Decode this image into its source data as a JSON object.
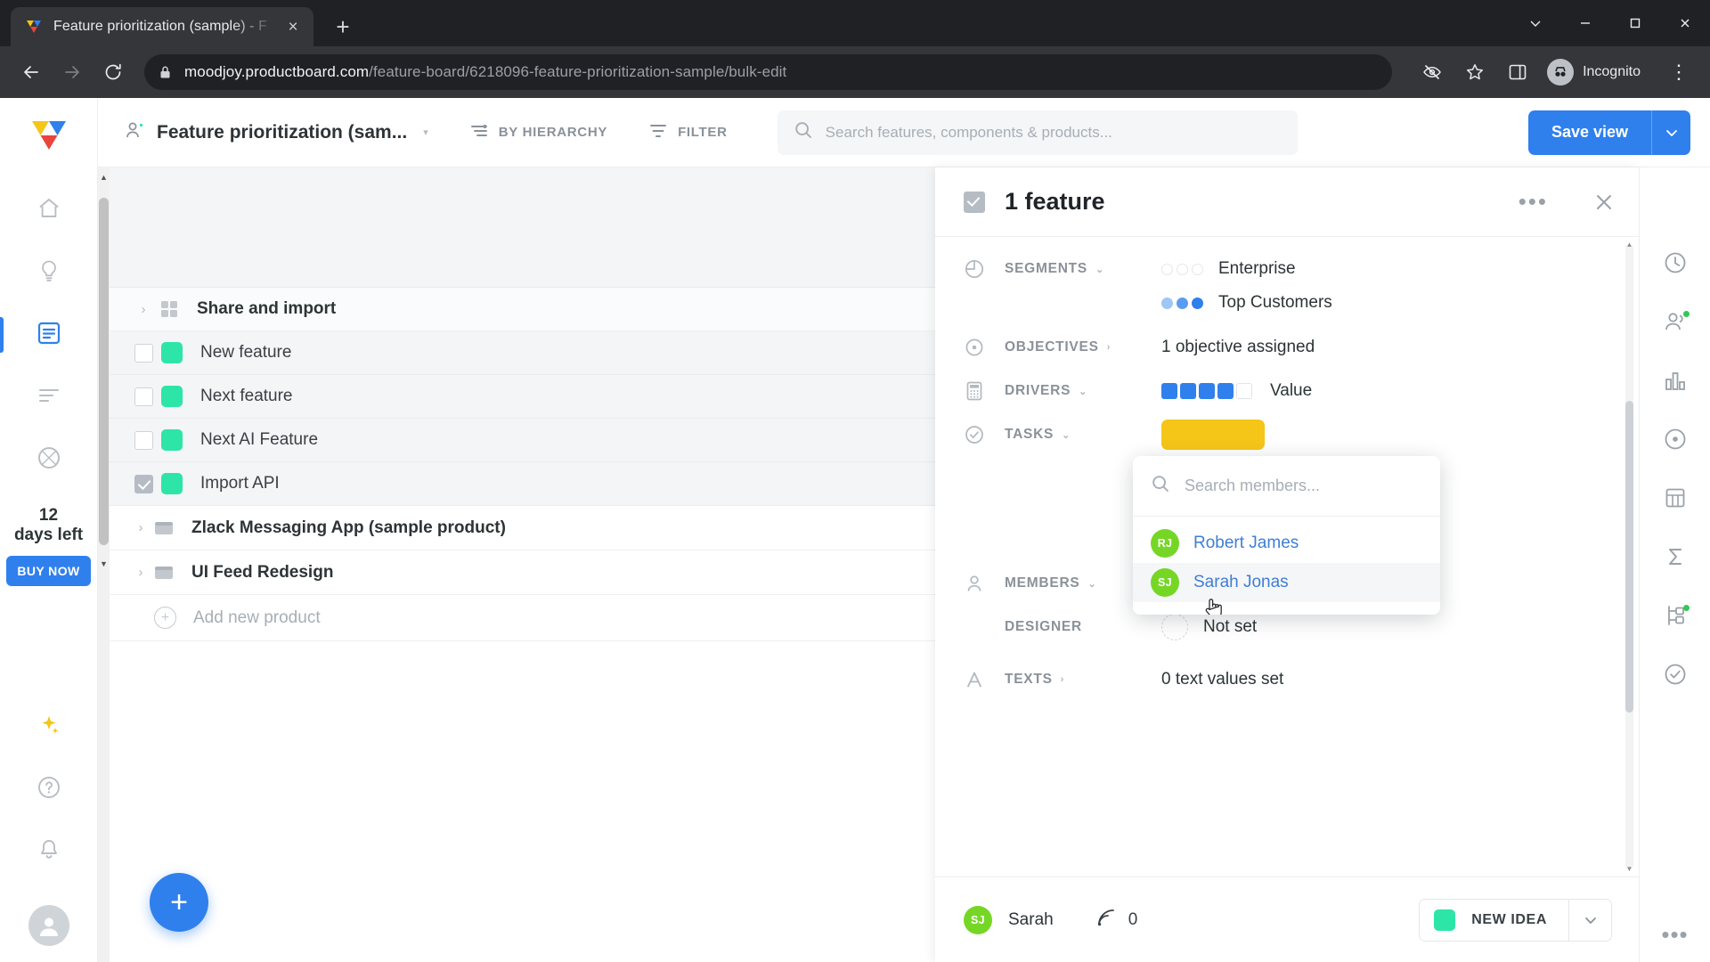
{
  "browser": {
    "tab": {
      "title": "Feature prioritization (sample) - F",
      "favicon": "productboard-logo-icon",
      "close": "×"
    },
    "newtab_label": "+",
    "window_controls": {
      "minimize_all": "chevron-down-icon",
      "minimize": "−",
      "maximize": "▢",
      "close": "✕"
    },
    "nav": {
      "back": "←",
      "forward": "→",
      "reload": "⟳"
    },
    "omnibox": {
      "lock": "lock-icon",
      "host": "moodjoy.productboard.com",
      "path": "/feature-board/6218096-feature-prioritization-sample/bulk-edit"
    },
    "omni_actions": {
      "third_party_cookies": "eye-slash-icon",
      "bookmark": "star-icon",
      "side_panel": "side-panel-icon"
    },
    "profile": {
      "label": "Incognito",
      "icon": "incognito-icon"
    },
    "menu": "⋮"
  },
  "left_rail": {
    "logo": "productboard-logo",
    "items": [
      {
        "name": "home",
        "icon": "home-icon"
      },
      {
        "name": "insights",
        "icon": "lightbulb-icon"
      },
      {
        "name": "features",
        "icon": "document-icon",
        "active": true
      },
      {
        "name": "roadmap",
        "icon": "lines-icon"
      },
      {
        "name": "objectives",
        "icon": "target-icon"
      }
    ],
    "trial": {
      "days": "12",
      "label": "days left",
      "cta": "BUY NOW"
    },
    "bottom": [
      {
        "name": "ai",
        "icon": "sparkles-icon"
      },
      {
        "name": "help",
        "icon": "question-circle-icon"
      },
      {
        "name": "notifications",
        "icon": "bell-icon"
      },
      {
        "name": "user-avatar",
        "icon": "avatar-icon"
      }
    ]
  },
  "header": {
    "board_title": "Feature prioritization (sam...",
    "board_caret": "▾",
    "hierarchy_label": "BY HIERARCHY",
    "filter_label": "FILTER",
    "search_placeholder": "Search features, components & products...",
    "save_view_label": "Save view",
    "save_view_caret": "⌄"
  },
  "feature_list": {
    "rows": [
      {
        "type": "group",
        "label": "Share and import",
        "icon": "grid-icon",
        "expand": "›",
        "checked": null
      },
      {
        "type": "feature",
        "label": "New feature",
        "swatch": "#2ee5a8",
        "checked": false
      },
      {
        "type": "feature",
        "label": "Next feature",
        "swatch": "#2ee5a8",
        "checked": false
      },
      {
        "type": "feature",
        "label": "Next AI Feature",
        "swatch": "#2ee5a8",
        "checked": false
      },
      {
        "type": "feature",
        "label": "Import API",
        "swatch": "#2ee5a8",
        "checked": true
      },
      {
        "type": "product",
        "label": "Zlack Messaging App (sample product)",
        "icon": "product-icon",
        "expand": "›"
      },
      {
        "type": "product",
        "label": "UI Feed Redesign",
        "icon": "product-icon",
        "expand": "›"
      },
      {
        "type": "add",
        "label": "Add new product",
        "icon": "plus-circle-icon"
      }
    ],
    "fab_label": "+"
  },
  "panel": {
    "title": "1 feature",
    "header_checked": true,
    "more_menu": "•••",
    "close": "✕",
    "fields": [
      {
        "name": "segments",
        "label": "SEGMENTS",
        "chev": "⌄",
        "icon": "pie-chart-icon",
        "values": [
          {
            "text": "Enterprise",
            "dots": [
              0,
              0,
              0
            ]
          },
          {
            "text": "Top Customers",
            "dots": [
              1,
              2,
              3
            ]
          }
        ]
      },
      {
        "name": "objectives",
        "label": "OBJECTIVES",
        "chev": "›",
        "icon": "target-icon",
        "value_text": "1 objective assigned"
      },
      {
        "name": "drivers",
        "label": "DRIVERS",
        "chev": "⌄",
        "icon": "calculator-icon",
        "squares": [
          1,
          1,
          1,
          1,
          0
        ],
        "value_text": "Value"
      },
      {
        "name": "tasks",
        "label": "TASKS",
        "chev": "⌄",
        "icon": "check-circle-icon",
        "value_pill_color": "#f5c518"
      },
      {
        "name": "members",
        "label": "MEMBERS",
        "chev": "⌄",
        "icon": "person-icon"
      },
      {
        "name": "designer",
        "label": "DESIGNER",
        "chev": "",
        "icon": "",
        "value_text": "Not set"
      },
      {
        "name": "texts",
        "label": "TEXTS",
        "chev": "›",
        "icon": "letter-a-icon",
        "value_text": "0 text values set"
      }
    ],
    "dropdown": {
      "search_placeholder": "Search members...",
      "search_icon": "search-icon",
      "members": [
        {
          "initials": "RJ",
          "name": "Robert James",
          "color": "#76d626",
          "hovered": false
        },
        {
          "initials": "SJ",
          "name": "Sarah Jonas",
          "color": "#76d626",
          "hovered": true
        }
      ]
    },
    "footer": {
      "avatar_initials": "SJ",
      "avatar_color": "#76d626",
      "name": "Sarah",
      "signal_icon": "signal-icon",
      "signal_value": "0",
      "new_idea_label": "NEW IDEA",
      "new_idea_swatch": "#2ee5a8",
      "new_idea_caret": "⌄"
    }
  },
  "right_rail": {
    "items": [
      {
        "name": "history",
        "icon": "clock-icon"
      },
      {
        "name": "users",
        "icon": "people-icon",
        "badge": true
      },
      {
        "name": "charts",
        "icon": "bar-chart-icon"
      },
      {
        "name": "status",
        "icon": "circle-dot-icon"
      },
      {
        "name": "data",
        "icon": "table-icon"
      },
      {
        "name": "formula",
        "icon": "sigma-icon"
      },
      {
        "name": "dependencies",
        "icon": "flow-icon",
        "badge": true
      },
      {
        "name": "checks",
        "icon": "check-badge-icon"
      }
    ],
    "more": "•••"
  }
}
